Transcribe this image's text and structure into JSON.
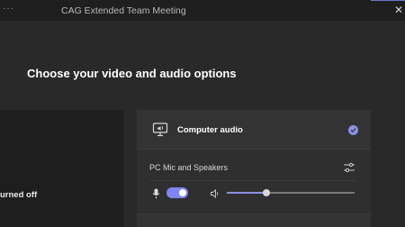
{
  "window": {
    "title": "CAG Extended Team Meeting",
    "menu_glyph": "···",
    "close_glyph": "✕"
  },
  "heading": "Choose your video and audio options",
  "video": {
    "status_text": "urned off"
  },
  "audio": {
    "option_label": "Computer audio",
    "option_selected": true,
    "device_label": "PC Mic and Speakers",
    "mic_enabled": true,
    "volume_level": 0.31
  },
  "colors": {
    "accent": "#8b8fe6",
    "toggle_on": "#7f85f5",
    "background": "#292929",
    "panel": "#2f2f2f"
  },
  "icons": {
    "computer": "computer-speaker-icon",
    "check": "checkmark-circle-icon",
    "settings": "device-settings-icon",
    "mic": "microphone-icon",
    "speaker": "speaker-icon"
  }
}
